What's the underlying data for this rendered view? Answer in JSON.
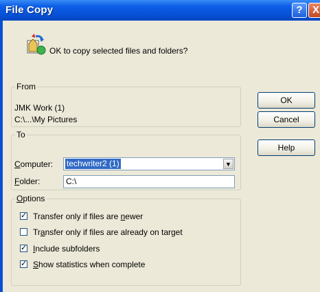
{
  "window": {
    "title": "File Copy",
    "help_glyph": "?",
    "close_glyph": "X"
  },
  "header": {
    "icon": "copy-files-icon",
    "message": "OK to copy selected files and folders?"
  },
  "from": {
    "legend": "From",
    "line1": "JMK Work (1)",
    "line2": "C:\\...\\My Pictures"
  },
  "to": {
    "legend": "To",
    "computer_label_u": "C",
    "computer_label_rest": "omputer:",
    "computer_value": "techwriter2 (1)",
    "folder_label_u": "F",
    "folder_label_rest": "older:",
    "folder_value": "C:\\"
  },
  "options": {
    "legend_u": "O",
    "legend_rest": "ptions",
    "items": [
      {
        "pre": "Transfer only if files are ",
        "u": "n",
        "post": "ewer",
        "checked": true
      },
      {
        "pre": "Tr",
        "u": "a",
        "post": "nsfer only if files are already on target",
        "checked": false
      },
      {
        "pre": "",
        "u": "I",
        "post": "nclude subfolders",
        "checked": true
      },
      {
        "pre": "",
        "u": "S",
        "post": "how statistics when complete",
        "checked": true
      }
    ]
  },
  "buttons": {
    "ok": "OK",
    "cancel": "Cancel",
    "help": "Help"
  },
  "colors": {
    "title_bar": "#0751d8",
    "dialog_face": "#ece9d8",
    "selection": "#316ac5"
  }
}
